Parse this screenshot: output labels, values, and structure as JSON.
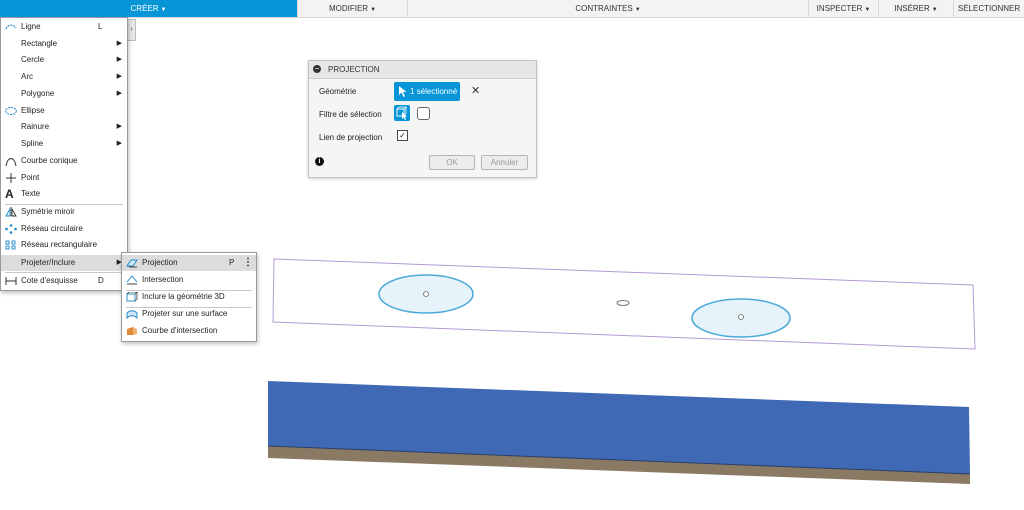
{
  "toolbar": {
    "create": "CRÉER",
    "modify": "MODIFIER",
    "constraints": "CONTRAINTES",
    "inspect": "INSPECTER",
    "insert": "INSÉRER",
    "select": "SÉLECTIONNER"
  },
  "create_menu": {
    "items": [
      {
        "label": "Ligne",
        "shortcut": "L",
        "icon": "line-icon"
      },
      {
        "label": "Rectangle",
        "submenu": true,
        "icon": "rectangle-icon"
      },
      {
        "label": "Cercle",
        "submenu": true,
        "icon": "circle-icon"
      },
      {
        "label": "Arc",
        "submenu": true,
        "icon": "arc-icon"
      },
      {
        "label": "Polygone",
        "submenu": true,
        "icon": "polygon-icon"
      },
      {
        "label": "Ellipse",
        "icon": "ellipse-icon"
      },
      {
        "label": "Rainure",
        "submenu": true,
        "icon": "slot-icon"
      },
      {
        "label": "Spline",
        "submenu": true,
        "icon": "spline-icon"
      },
      {
        "label": "Courbe conique",
        "icon": "conic-curve-icon"
      },
      {
        "label": "Point",
        "icon": "point-icon"
      },
      {
        "label": "Texte",
        "icon": "text-icon"
      },
      {
        "label": "Symétrie miroir",
        "icon": "mirror-icon"
      },
      {
        "label": "Réseau circulaire",
        "icon": "circular-pattern-icon"
      },
      {
        "label": "Réseau rectangulaire",
        "icon": "rectangular-pattern-icon"
      },
      {
        "label": "Projeter/Inclure",
        "submenu": true,
        "icon": "project-include-icon"
      },
      {
        "label": "Cote d'esquisse",
        "shortcut": "D",
        "icon": "sketch-dimension-icon"
      }
    ]
  },
  "project_submenu": {
    "items": [
      {
        "label": "Projection",
        "shortcut": "P",
        "icon": "projection-icon"
      },
      {
        "label": "Intersection",
        "icon": "intersection-icon"
      },
      {
        "label": "Inclure la géométrie 3D",
        "icon": "include-3d-icon"
      },
      {
        "label": "Projeter sur une surface",
        "icon": "project-surface-icon"
      },
      {
        "label": "Courbe d'intersection",
        "icon": "intersection-curve-icon"
      }
    ]
  },
  "projection_dialog": {
    "title": "PROJECTION",
    "geometry_label": "Géométrie",
    "geometry_value": "1 sélectionné",
    "filter_label": "Filtre de sélection",
    "link_label": "Lien de projection",
    "link_checked": true,
    "ok": "OK",
    "cancel": "Annuler"
  },
  "colors": {
    "accent": "#0696d7",
    "sketch_fill": "#e6f3fa",
    "sketch_stroke": "#4aa9d8",
    "sketch_boundary": "#b49ad6",
    "body_top": "#3f69b4",
    "body_side": "#8a7a64"
  }
}
